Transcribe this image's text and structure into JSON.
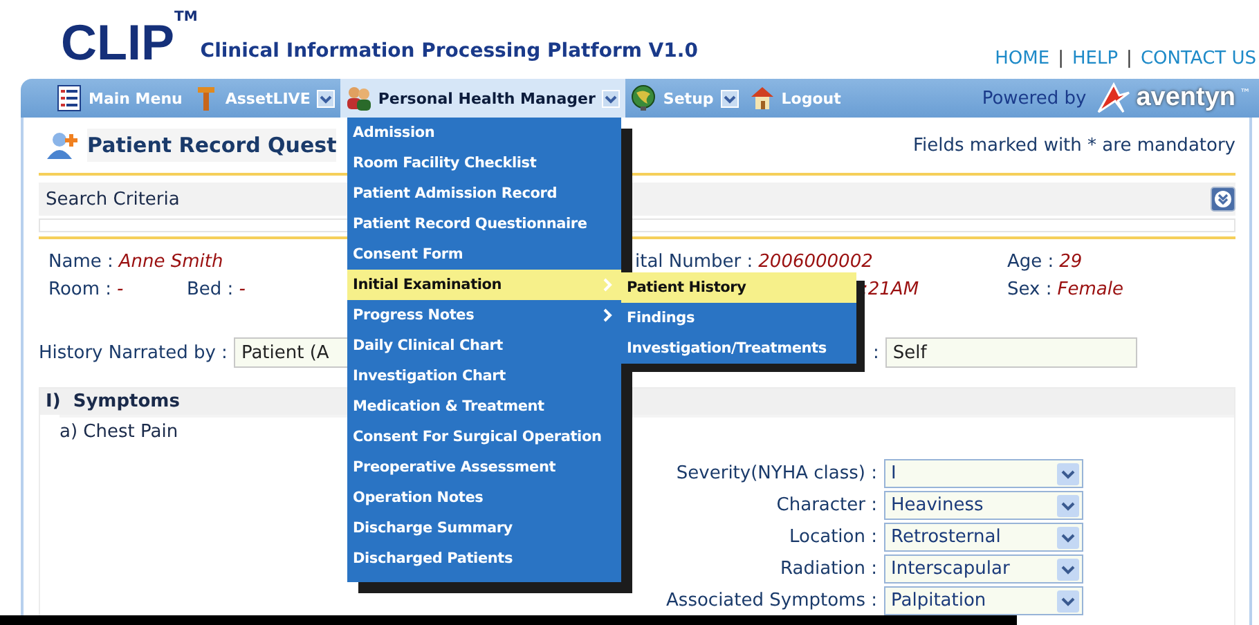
{
  "header": {
    "logo": "CLIP",
    "trademark": "TM",
    "subtitle": "Clinical Information Processing Platform V1.0",
    "links": [
      "HOME",
      "HELP",
      "CONTACT US"
    ],
    "separator": "|"
  },
  "nav": {
    "items": [
      {
        "label": "Main Menu",
        "dropdown": false,
        "selected": false
      },
      {
        "label": "AssetLIVE",
        "dropdown": true,
        "selected": false
      },
      {
        "label": "Personal Health Manager",
        "dropdown": true,
        "selected": true
      },
      {
        "label": "Setup",
        "dropdown": true,
        "selected": false
      },
      {
        "label": "Logout",
        "dropdown": false,
        "selected": false
      }
    ],
    "powered_by": "Powered by",
    "brand": "aventyn",
    "brand_mark": "™"
  },
  "page": {
    "title": "Patient Record Quest",
    "mandatory_note": "Fields marked with * are mandatory",
    "search_criteria": "Search Criteria"
  },
  "patient": {
    "name": {
      "label": "Name :",
      "value": "Anne Smith"
    },
    "hospital_number": {
      "label": "ital Number :",
      "value": "2006000002"
    },
    "age": {
      "label": "Age :",
      "value": "29"
    },
    "room": {
      "label": "Room :",
      "value": "-"
    },
    "bed": {
      "label": "Bed :",
      "value": "-"
    },
    "time": {
      "value": ":21AM"
    },
    "sex": {
      "label": "Sex :",
      "value": "Female"
    }
  },
  "history": [
    {
      "label": "History Narrated by :",
      "value": "Patient (A"
    },
    {
      "label": ":",
      "value": "Self"
    }
  ],
  "symptoms": {
    "heading": "I)  Symptoms",
    "subheading": "a) Chest Pain",
    "fields": [
      {
        "label": "Severity(NYHA class) :",
        "value": "I"
      },
      {
        "label": "Character :",
        "value": "Heaviness"
      },
      {
        "label": "Location :",
        "value": "Retrosternal"
      },
      {
        "label": "Radiation :",
        "value": "Interscapular"
      },
      {
        "label": "Associated Symptoms :",
        "value": "Palpitation"
      }
    ]
  },
  "menu": {
    "items": [
      {
        "label": "Admission",
        "selected": false,
        "has_submenu": false
      },
      {
        "label": "Room Facility Checklist",
        "selected": false,
        "has_submenu": false
      },
      {
        "label": "Patient Admission Record",
        "selected": false,
        "has_submenu": false
      },
      {
        "label": "Patient Record Questionnaire",
        "selected": false,
        "has_submenu": false
      },
      {
        "label": "Consent Form",
        "selected": false,
        "has_submenu": false
      },
      {
        "label": "Initial Examination",
        "selected": true,
        "has_submenu": true,
        "submenu": [
          {
            "label": "Patient History",
            "selected": true
          },
          {
            "label": "Findings",
            "selected": false
          },
          {
            "label": "Investigation/Treatments",
            "selected": false
          }
        ]
      },
      {
        "label": "Progress Notes",
        "selected": false,
        "has_submenu": true
      },
      {
        "label": "Daily Clinical Chart",
        "selected": false,
        "has_submenu": false
      },
      {
        "label": "Investigation Chart",
        "selected": false,
        "has_submenu": false
      },
      {
        "label": "Medication & Treatment",
        "selected": false,
        "has_submenu": false
      },
      {
        "label": "Consent For Surgical Operation",
        "selected": false,
        "has_submenu": false
      },
      {
        "label": "Preoperative Assessment",
        "selected": false,
        "has_submenu": false
      },
      {
        "label": "Operation Notes",
        "selected": false,
        "has_submenu": false
      },
      {
        "label": "Discharge Summary",
        "selected": false,
        "has_submenu": false
      },
      {
        "label": "Discharged Patients",
        "selected": false,
        "has_submenu": false
      }
    ]
  }
}
